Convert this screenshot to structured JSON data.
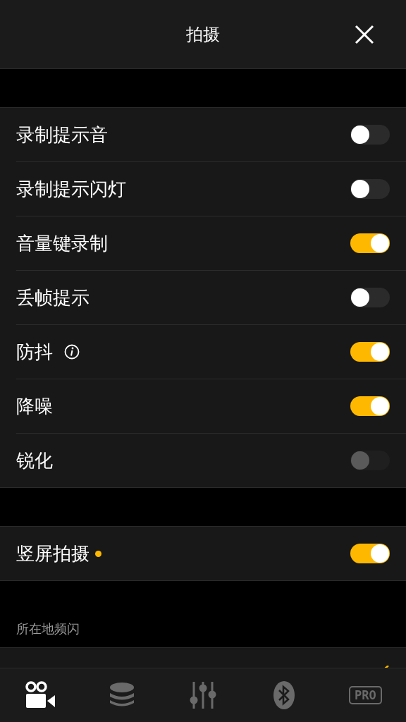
{
  "header": {
    "title": "拍摄"
  },
  "groups": [
    {
      "kind": "toggles",
      "items": [
        {
          "label": "录制提示音",
          "on": false,
          "disabled": false,
          "info": false,
          "dot": false
        },
        {
          "label": "录制提示闪灯",
          "on": false,
          "disabled": false,
          "info": false,
          "dot": false
        },
        {
          "label": "音量键录制",
          "on": true,
          "disabled": false,
          "info": false,
          "dot": false
        },
        {
          "label": "丢帧提示",
          "on": false,
          "disabled": false,
          "info": false,
          "dot": false
        },
        {
          "label": "防抖",
          "on": true,
          "disabled": false,
          "info": true,
          "dot": false
        },
        {
          "label": "降噪",
          "on": true,
          "disabled": false,
          "info": false,
          "dot": false
        },
        {
          "label": "锐化",
          "on": false,
          "disabled": true,
          "info": false,
          "dot": false
        }
      ]
    },
    {
      "kind": "toggles",
      "items": [
        {
          "label": "竖屏拍摄",
          "on": true,
          "disabled": false,
          "info": false,
          "dot": true
        }
      ]
    },
    {
      "kind": "choices",
      "caption": "所在地频闪",
      "items": [
        {
          "selected": true
        }
      ]
    }
  ],
  "tabs": [
    {
      "selected": true
    },
    {
      "selected": false
    },
    {
      "selected": false
    },
    {
      "selected": false
    },
    {
      "label": "PRO",
      "selected": false
    }
  ]
}
